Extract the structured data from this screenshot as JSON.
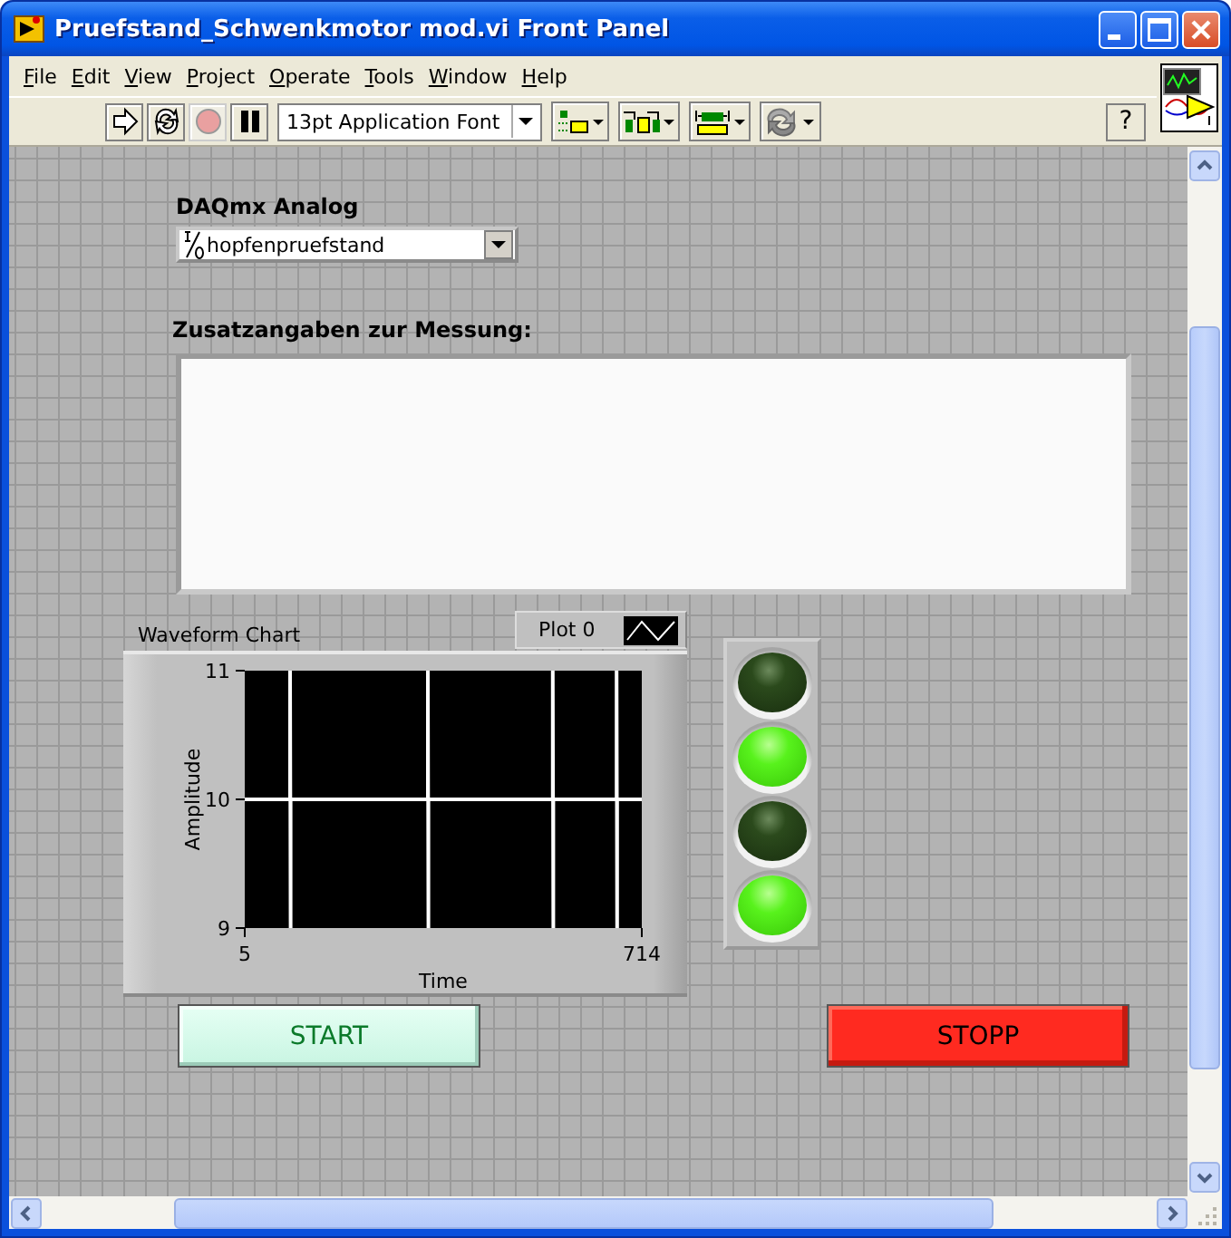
{
  "window": {
    "title": "Pruefstand_Schwenkmotor mod.vi Front Panel"
  },
  "menu": [
    "File",
    "Edit",
    "View",
    "Project",
    "Operate",
    "Tools",
    "Window",
    "Help"
  ],
  "toolbar": {
    "buttons": [
      {
        "kind": "run",
        "disabled": false
      },
      {
        "kind": "run_continuously",
        "disabled": false
      },
      {
        "kind": "abort",
        "disabled": true
      },
      {
        "kind": "pause",
        "disabled": false
      }
    ],
    "font_ring": "13pt Application Font",
    "tools": [
      {
        "kind": "align"
      },
      {
        "kind": "distribute"
      },
      {
        "kind": "resize"
      },
      {
        "kind": "reorder"
      }
    ],
    "help": "?"
  },
  "daqmx": {
    "label": "DAQmx Analog",
    "value": "hopfenpruefstand"
  },
  "notes": {
    "label": "Zusatzangaben zur Messung:"
  },
  "chart": {
    "label": "Waveform Chart",
    "chart_data": {
      "type": "line",
      "xlabel": "Time",
      "ylabel": "Amplitude",
      "x": [
        5,
        86,
        86,
        87,
        87,
        332,
        332,
        333,
        333,
        555,
        555,
        556,
        556,
        669,
        669,
        670,
        670,
        714
      ],
      "series": [
        {
          "name": "Plot 0",
          "color": "#ffffff",
          "values": [
            10,
            10,
            11,
            9,
            10,
            10,
            11,
            9,
            10,
            10,
            11,
            9,
            10,
            10,
            11,
            9,
            10,
            10
          ]
        }
      ],
      "xlim": [
        5,
        714
      ],
      "ylim": [
        9,
        11
      ],
      "xticks": [
        5,
        714
      ],
      "yticks": [
        9,
        10,
        11
      ]
    }
  },
  "leds": [
    {
      "on": false
    },
    {
      "on": true
    },
    {
      "on": false
    },
    {
      "on": true
    }
  ],
  "buttons": [
    {
      "kind": "start",
      "label": "START"
    },
    {
      "kind": "stop",
      "label": "STOPP"
    }
  ]
}
